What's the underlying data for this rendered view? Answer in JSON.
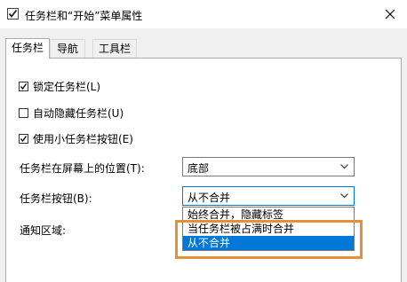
{
  "window": {
    "title": "任务栏和“开始”菜单属性",
    "icon": "taskbar-properties-icon",
    "close_icon": "close-icon"
  },
  "tabs": [
    {
      "label": "任务栏",
      "active": true
    },
    {
      "label": "导航",
      "active": false
    },
    {
      "label": "工具栏",
      "active": false
    }
  ],
  "checkboxes": [
    {
      "label": "锁定任务栏(L)",
      "checked": true
    },
    {
      "label": "自动隐藏任务栏(U)",
      "checked": false
    },
    {
      "label": "使用小任务栏按钮(E)",
      "checked": true
    }
  ],
  "fields": {
    "position": {
      "label": "任务栏在屏幕上的位置(T):",
      "value": "底部"
    },
    "buttons": {
      "label": "任务栏按钮(B):",
      "value": "从不合并",
      "options": [
        "始终合并，隐藏标签",
        "当任务栏被占满时合并",
        "从不合并"
      ],
      "selected_index": 2
    },
    "notification_area": {
      "label": "通知区域:"
    }
  },
  "colors": {
    "accent": "#0078d7",
    "highlight_border": "#e69035"
  }
}
